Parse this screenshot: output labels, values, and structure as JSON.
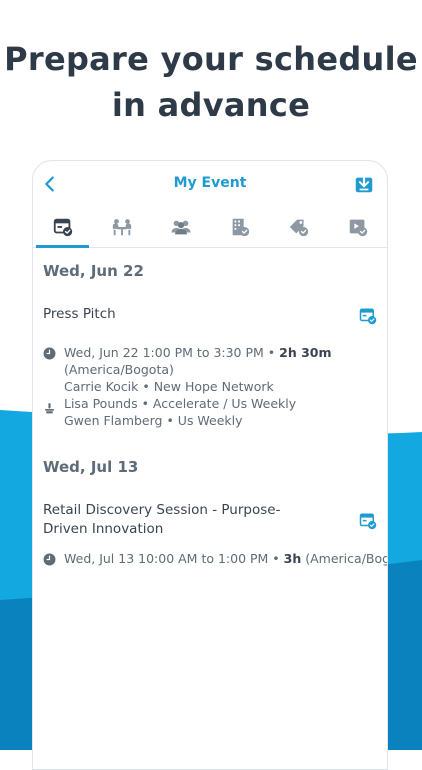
{
  "headline": {
    "line1": "Prepare your schedule",
    "line2": "in advance"
  },
  "appbar": {
    "title": "My Event",
    "back_icon": "chevron-left-icon",
    "download_icon": "download-icon"
  },
  "tabs": [
    {
      "icon": "my-schedule-icon",
      "active": true
    },
    {
      "icon": "meetings-icon",
      "active": false
    },
    {
      "icon": "attendees-icon",
      "active": false
    },
    {
      "icon": "exhibitors-icon",
      "active": false
    },
    {
      "icon": "sponsors-icon",
      "active": false
    },
    {
      "icon": "sessions-icon",
      "active": false
    }
  ],
  "days": [
    {
      "date": "Wed, Jun 22",
      "sessions": [
        {
          "title_lines": [
            "Press Pitch"
          ],
          "time": "Wed, Jun 22 1:00 PM to 3:30 PM",
          "separator": " • ",
          "duration": "2h 30m",
          "timezone": "(America/Bogota)",
          "speakers": [
            "Carrie Kocik • New Hope Network",
            "Lisa Pounds • Accelerate / Us Weekly",
            "Gwen Flamberg • Us Weekly"
          ]
        }
      ]
    },
    {
      "date": "Wed, Jul 13",
      "sessions": [
        {
          "title_lines": [
            "Retail Discovery Session - Purpose-",
            "Driven Innovation"
          ],
          "time": "Wed, Jul 13 10:00 AM to 1:00 PM",
          "separator": " • ",
          "duration": "3h",
          "timezone": "(America/Bogota)"
        }
      ]
    }
  ],
  "colors": {
    "accent": "#1f9bd1",
    "wave_light": "#14a8e1",
    "wave_dark": "#0a82bd"
  }
}
